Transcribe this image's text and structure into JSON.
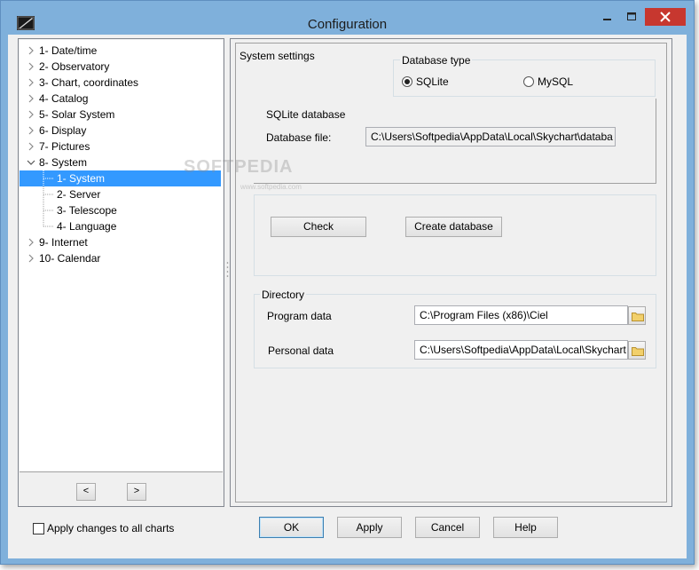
{
  "window": {
    "title": "Configuration",
    "accent": "#7fb0db",
    "close_color": "#c7372f"
  },
  "tree": {
    "items": [
      {
        "label": "1- Date/time",
        "level": 0,
        "expanded": false
      },
      {
        "label": "2- Observatory",
        "level": 0,
        "expanded": false
      },
      {
        "label": "3- Chart, coordinates",
        "level": 0,
        "expanded": false
      },
      {
        "label": "4- Catalog",
        "level": 0,
        "expanded": false
      },
      {
        "label": "5- Solar System",
        "level": 0,
        "expanded": false
      },
      {
        "label": "6- Display",
        "level": 0,
        "expanded": false
      },
      {
        "label": "7- Pictures",
        "level": 0,
        "expanded": false
      },
      {
        "label": "8- System",
        "level": 0,
        "expanded": true
      },
      {
        "label": "1- System",
        "level": 1,
        "selected": true
      },
      {
        "label": "2- Server",
        "level": 1
      },
      {
        "label": "3- Telescope",
        "level": 1
      },
      {
        "label": "4- Language",
        "level": 1
      },
      {
        "label": "9- Internet",
        "level": 0,
        "expanded": false
      },
      {
        "label": "10- Calendar",
        "level": 0,
        "expanded": false
      }
    ],
    "prev_label": "<",
    "next_label": ">",
    "selection_color": "#3399ff"
  },
  "system": {
    "section_label": "System settings",
    "db_type": {
      "label": "Database type",
      "option_sqlite": "SQLite",
      "option_mysql": "MySQL",
      "selected": "SQLite"
    },
    "sqlite": {
      "label": "SQLite database",
      "file_label": "Database file:",
      "file_value": "C:\\Users\\Softpedia\\AppData\\Local\\Skychart\\databa"
    },
    "check_button": "Check",
    "create_button": "Create database",
    "directory": {
      "label": "Directory",
      "program_label": "Program data",
      "program_value": "C:\\Program Files (x86)\\Ciel",
      "personal_label": "Personal data",
      "personal_value": "C:\\Users\\Softpedia\\AppData\\Local\\Skychart"
    }
  },
  "footer": {
    "apply_all_label": "Apply changes to all charts",
    "apply_all_checked": false,
    "ok_label": "OK",
    "apply_label": "Apply",
    "cancel_label": "Cancel",
    "help_label": "Help"
  },
  "watermark": {
    "text": "SOFTPEDIA",
    "sub": "www.softpedia.com"
  }
}
